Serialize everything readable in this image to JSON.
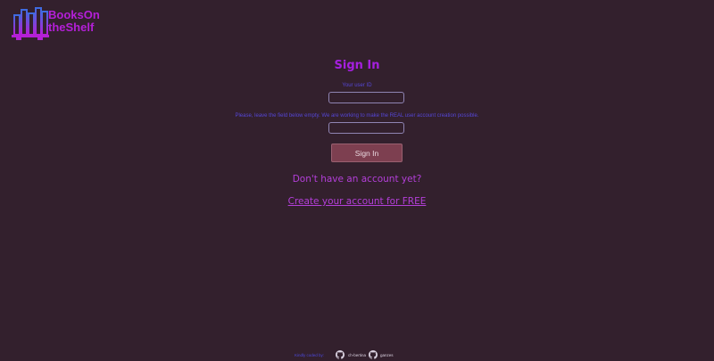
{
  "logo": {
    "line1": "BooksOn",
    "line2": "theShelf"
  },
  "signin": {
    "title": "Sign In",
    "user_id_label": "Your user ID",
    "hint": "Please, leave the field below empty. We are working to make the REAL user account creation possible.",
    "user_id_value": "",
    "second_field_value": "",
    "button_label": "Sign In"
  },
  "account": {
    "question": "Don't have an account yet?",
    "create_link": "Create your account for FREE"
  },
  "footer": {
    "credit": "Kindly coded by:",
    "author1": "ch-bertina",
    "author2": "ganzes"
  },
  "colors": {
    "background": "#33202d",
    "accent": "#a61fe0",
    "label": "#5546d6",
    "button": "#7d3f50"
  },
  "icons": [
    "books-shelf-logo-icon",
    "github-icon"
  ]
}
